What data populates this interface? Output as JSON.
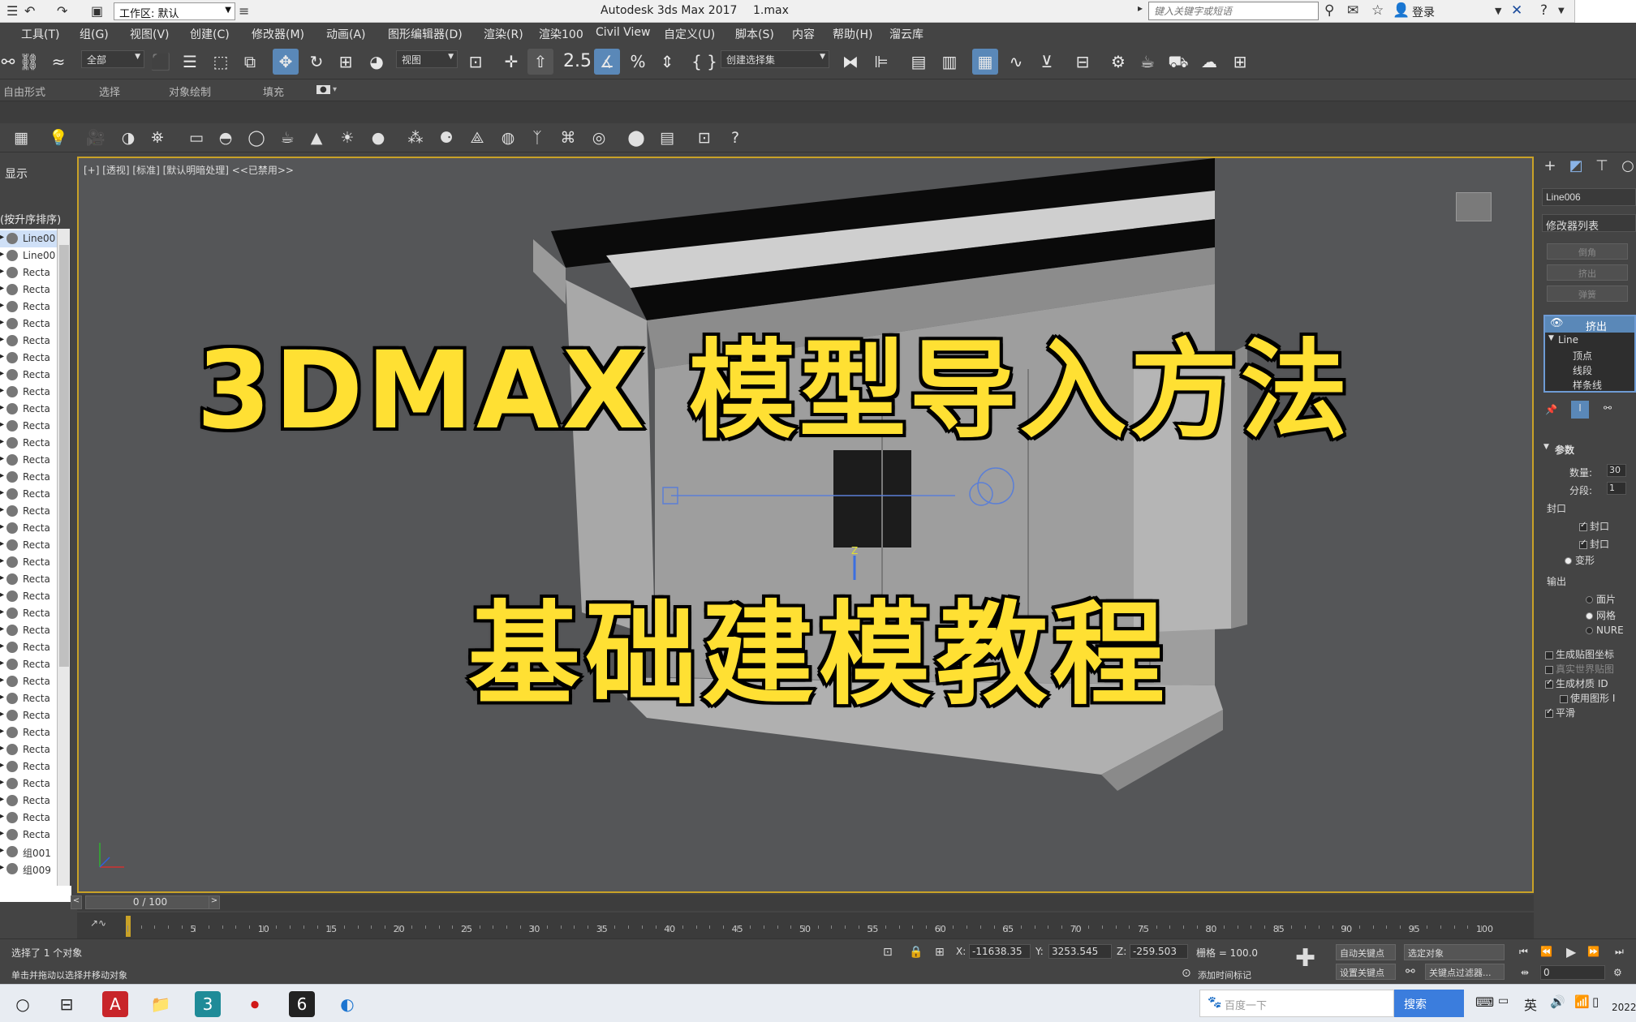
{
  "titlebar": {
    "workspace_label": "工作区: 默认",
    "app_title": "Autodesk 3ds Max 2017",
    "filename": "1.max",
    "search_placeholder": "键入关键字或短语",
    "login_label": "登录"
  },
  "menu": [
    "工具(T)",
    "组(G)",
    "视图(V)",
    "创建(C)",
    "修改器(M)",
    "动画(A)",
    "图形编辑器(D)",
    "渲染(R)",
    "渲染100",
    "Civil View",
    "自定义(U)",
    "脚本(S)",
    "内容",
    "帮助(H)",
    "溜云库"
  ],
  "toolbar": {
    "filter_select": "全部",
    "view_select": "视图",
    "snap_label": "2.5",
    "named_selection": "创建选择集"
  },
  "ribbon_tabs": [
    "自由形式",
    "选择",
    "对象绘制",
    "填充"
  ],
  "explorer": {
    "header": "显示",
    "sort_label": "(按升序排序)",
    "items": [
      "Line00",
      "Line00",
      "Recta",
      "Recta",
      "Recta",
      "Recta",
      "Recta",
      "Recta",
      "Recta",
      "Recta",
      "Recta",
      "Recta",
      "Recta",
      "Recta",
      "Recta",
      "Recta",
      "Recta",
      "Recta",
      "Recta",
      "Recta",
      "Recta",
      "Recta",
      "Recta",
      "Recta",
      "Recta",
      "Recta",
      "Recta",
      "Recta",
      "Recta",
      "Recta",
      "Recta",
      "Recta",
      "Recta",
      "Recta",
      "Recta",
      "Recta",
      "组001",
      "组009"
    ]
  },
  "viewport": {
    "label": "[+] [透视] [标准] [默认明暗处理] <<已禁用>>",
    "overlay_line1": "3DMAX 模型导入方法",
    "overlay_line2": "基础建模教程"
  },
  "command_panel": {
    "object_name": "Line006",
    "modifier_list": "修改器列表",
    "buttons": [
      "倒角",
      "挤出",
      "弹簧"
    ],
    "stack_top": "挤出",
    "stack_items": [
      "Line",
      "顶点",
      "线段",
      "样条线"
    ],
    "params_title": "参数",
    "amount_label": "数量:",
    "amount_value": "30",
    "segments_label": "分段:",
    "segments_value": "1",
    "cap_label": "封口",
    "cap_start": "封口",
    "cap_end": "封口",
    "morph": "变形",
    "output_label": "输出",
    "output_patch": "面片",
    "output_mesh": "网格",
    "output_nurbs": "NURE",
    "gen_map": "生成贴图坐标",
    "real_world": "真实世界贴图",
    "gen_matid": "生成材质 ID",
    "use_shape": "使用图形 I",
    "smooth": "平滑"
  },
  "timeline": {
    "frame_label": "0 / 100",
    "ticks": [
      "0",
      "5",
      "10",
      "15",
      "20",
      "25",
      "30",
      "35",
      "40",
      "45",
      "50",
      "55",
      "60",
      "65",
      "70",
      "75",
      "80",
      "85",
      "90",
      "95",
      "100"
    ]
  },
  "status": {
    "selection_text": "选择了 1 个对象",
    "prompt_text": "单击并拖动以选择并移动对象",
    "x_label": "X:",
    "x_value": "-11638.35",
    "y_label": "Y:",
    "y_value": "3253.545",
    "z_label": "Z:",
    "z_value": "-259.503",
    "grid_text": "栅格 = 100.0",
    "auto_key": "自动关键点",
    "set_key": "设置关键点",
    "selected_obj": "选定对象",
    "key_filter": "关键点过滤器...",
    "add_time_tag": "添加时间标记",
    "frame_value": "0"
  },
  "taskbar": {
    "search_placeholder": "百度一下",
    "search_button": "搜索",
    "ime": "英",
    "clock": "2022"
  },
  "colors": {
    "viewport_border": "#c9a227",
    "overlay_text": "#ffe033",
    "accent": "#5a88b8"
  }
}
